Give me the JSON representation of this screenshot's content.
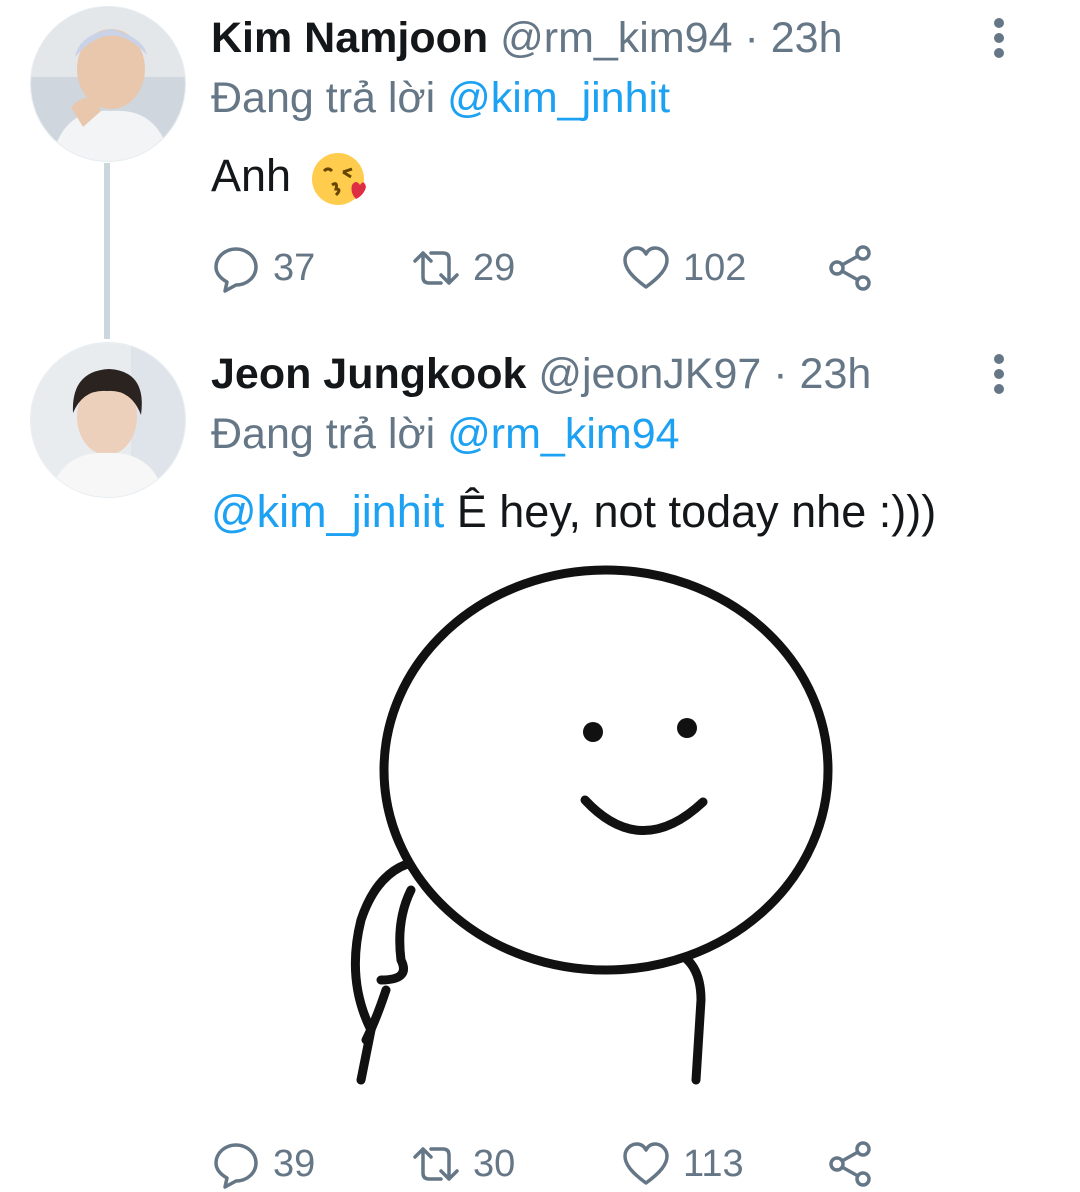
{
  "tweets": [
    {
      "display_name": "Kim Namjoon",
      "handle": "@rm_kim94",
      "separator": "·",
      "time": "23h",
      "reply_prefix": "Đang trả lời",
      "reply_to": "@kim_jinhit",
      "text": "Anh",
      "emoji": "😘",
      "counts": {
        "replies": "37",
        "retweets": "29",
        "likes": "102"
      }
    },
    {
      "display_name": "Jeon Jungkook",
      "handle": "@jeonJK97",
      "separator": "·",
      "time": "23h",
      "reply_prefix": "Đang trả lời",
      "reply_to": "@rm_kim94",
      "text_mention": "@kim_jinhit",
      "text": "Ê hey, not today nhe :)))",
      "counts": {
        "replies": "39",
        "retweets": "30",
        "likes": "113"
      }
    }
  ],
  "icons": {
    "reply": "reply-icon",
    "retweet": "retweet-icon",
    "like": "heart-icon",
    "share": "share-icon",
    "more": "more-vertical-icon"
  },
  "colors": {
    "link": "#1da1f2",
    "muted": "#657786",
    "text": "#14171a",
    "thread_line": "#ccd6dd"
  }
}
